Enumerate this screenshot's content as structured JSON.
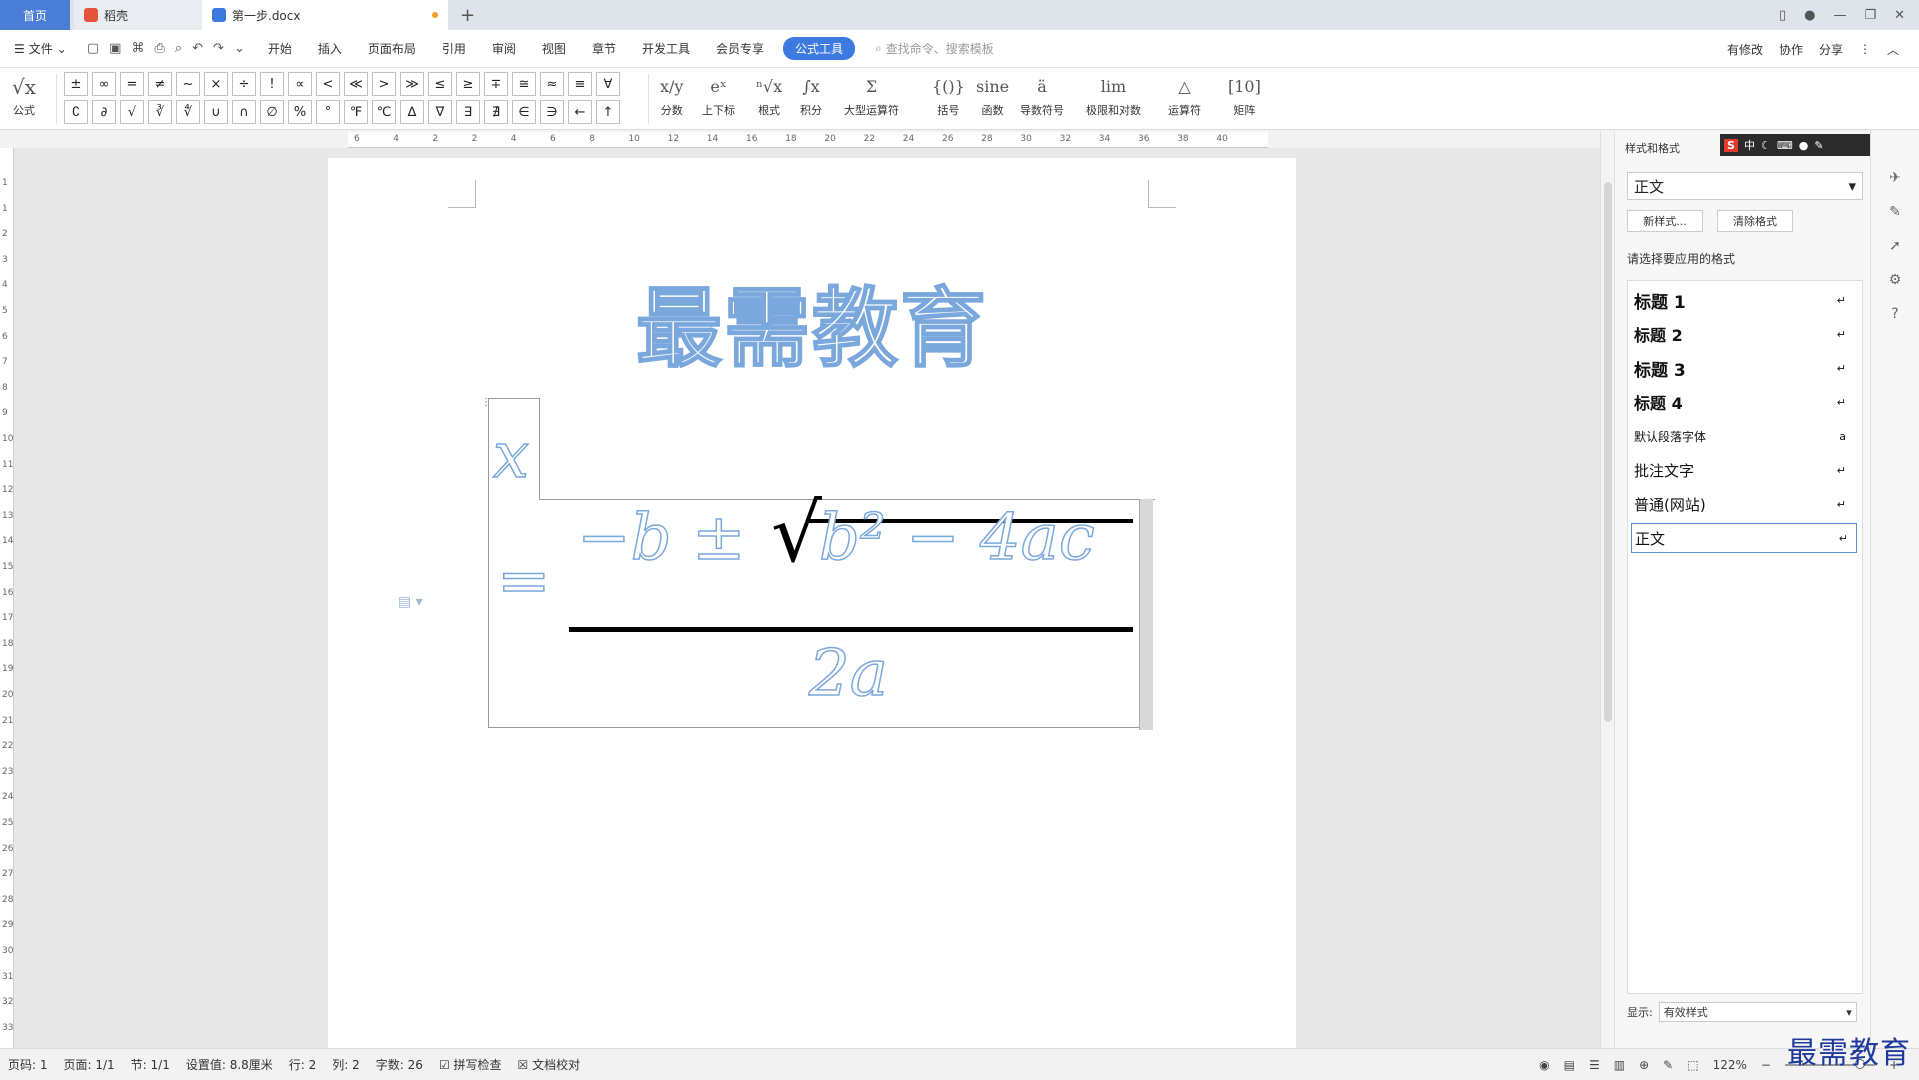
{
  "tabs": {
    "home": "首页",
    "t2": "稻壳",
    "t3": "第一步.docx",
    "add": "+"
  },
  "menu": {
    "file": "文件",
    "items": [
      "开始",
      "插入",
      "页面布局",
      "引用",
      "审阅",
      "视图",
      "章节",
      "开发工具",
      "会员专享"
    ],
    "active": "公式工具",
    "search": "查找命令、搜索模板",
    "acts": [
      "有修改",
      "协作",
      "分享"
    ]
  },
  "ribbon": {
    "formula": "公式",
    "symbols": [
      "±",
      "∞",
      "=",
      "≠",
      "~",
      "×",
      "÷",
      "!",
      "∝",
      "<",
      "≪",
      ">",
      "≫",
      "≤",
      "≥",
      "∓",
      "≅",
      "≈",
      "≡",
      "∀",
      "∁",
      "∂",
      "√",
      "∛",
      "∜",
      "∪",
      "∩",
      "∅",
      "%",
      "°",
      "℉",
      "℃",
      "∆",
      "∇",
      "∃",
      "∄",
      "∈",
      "∋",
      "←",
      "↑"
    ],
    "buttons": [
      {
        "icon": "x/y",
        "label": "分数"
      },
      {
        "icon": "eˣ",
        "label": "上下标"
      },
      {
        "icon": "ⁿ√x",
        "label": "根式"
      },
      {
        "icon": "∫x",
        "label": "积分"
      },
      {
        "icon": "Σ",
        "label": "大型运算符"
      },
      {
        "icon": "{()}",
        "label": "括号"
      },
      {
        "icon": "sine",
        "label": "函数"
      },
      {
        "icon": "ä",
        "label": "导数符号"
      },
      {
        "icon": "lim",
        "label": "极限和对数"
      },
      {
        "icon": "△",
        "label": "运算符"
      },
      {
        "icon": "[10]",
        "label": "矩阵"
      }
    ]
  },
  "ruler": {
    "h": [
      "6",
      "4",
      "2",
      "2",
      "4",
      "6",
      "8",
      "10",
      "12",
      "14",
      "16",
      "18",
      "20",
      "22",
      "24",
      "26",
      "28",
      "30",
      "32",
      "34",
      "36",
      "38",
      "40"
    ],
    "v": [
      "1",
      "1",
      "2",
      "3",
      "4",
      "5",
      "6",
      "7",
      "8",
      "9",
      "10",
      "11",
      "12",
      "13",
      "14",
      "15",
      "16",
      "17",
      "18",
      "19",
      "20",
      "21",
      "22",
      "23",
      "24",
      "25",
      "26",
      "27",
      "28",
      "29",
      "30",
      "31",
      "32",
      "33"
    ]
  },
  "doc": {
    "title": "最需教育",
    "eq": {
      "lhs": "x",
      "eq": "=",
      "num": "−b ± ",
      "rad": "b² − 4ac",
      "den": "2a"
    }
  },
  "pane": {
    "header": "样式和格式",
    "current": "正文",
    "newstyle": "新样式...",
    "clear": "清除格式",
    "prompt": "请选择要应用的格式",
    "styles": [
      {
        "name": "标题 1",
        "mark": "↵"
      },
      {
        "name": "标题 2",
        "mark": "↵"
      },
      {
        "name": "标题 3",
        "mark": "↵"
      },
      {
        "name": "标题 4",
        "mark": "↵"
      },
      {
        "name": "默认段落字体",
        "mark": "a"
      },
      {
        "name": "批注文字",
        "mark": "↵"
      },
      {
        "name": "普通(网站)",
        "mark": "↵"
      },
      {
        "name": "正文",
        "mark": "↵"
      }
    ],
    "showlabel": "显示:",
    "showvalue": "有效样式"
  },
  "ime": {
    "s": "S",
    "zh": "中"
  },
  "status": {
    "items": [
      "页码: 1",
      "页面: 1/1",
      "节: 1/1",
      "设置值: 8.8厘米",
      "行: 2",
      "列: 2",
      "字数: 26",
      "拼写检查",
      "文档校对"
    ],
    "zoom": "122%"
  },
  "watermark": "最需教育"
}
